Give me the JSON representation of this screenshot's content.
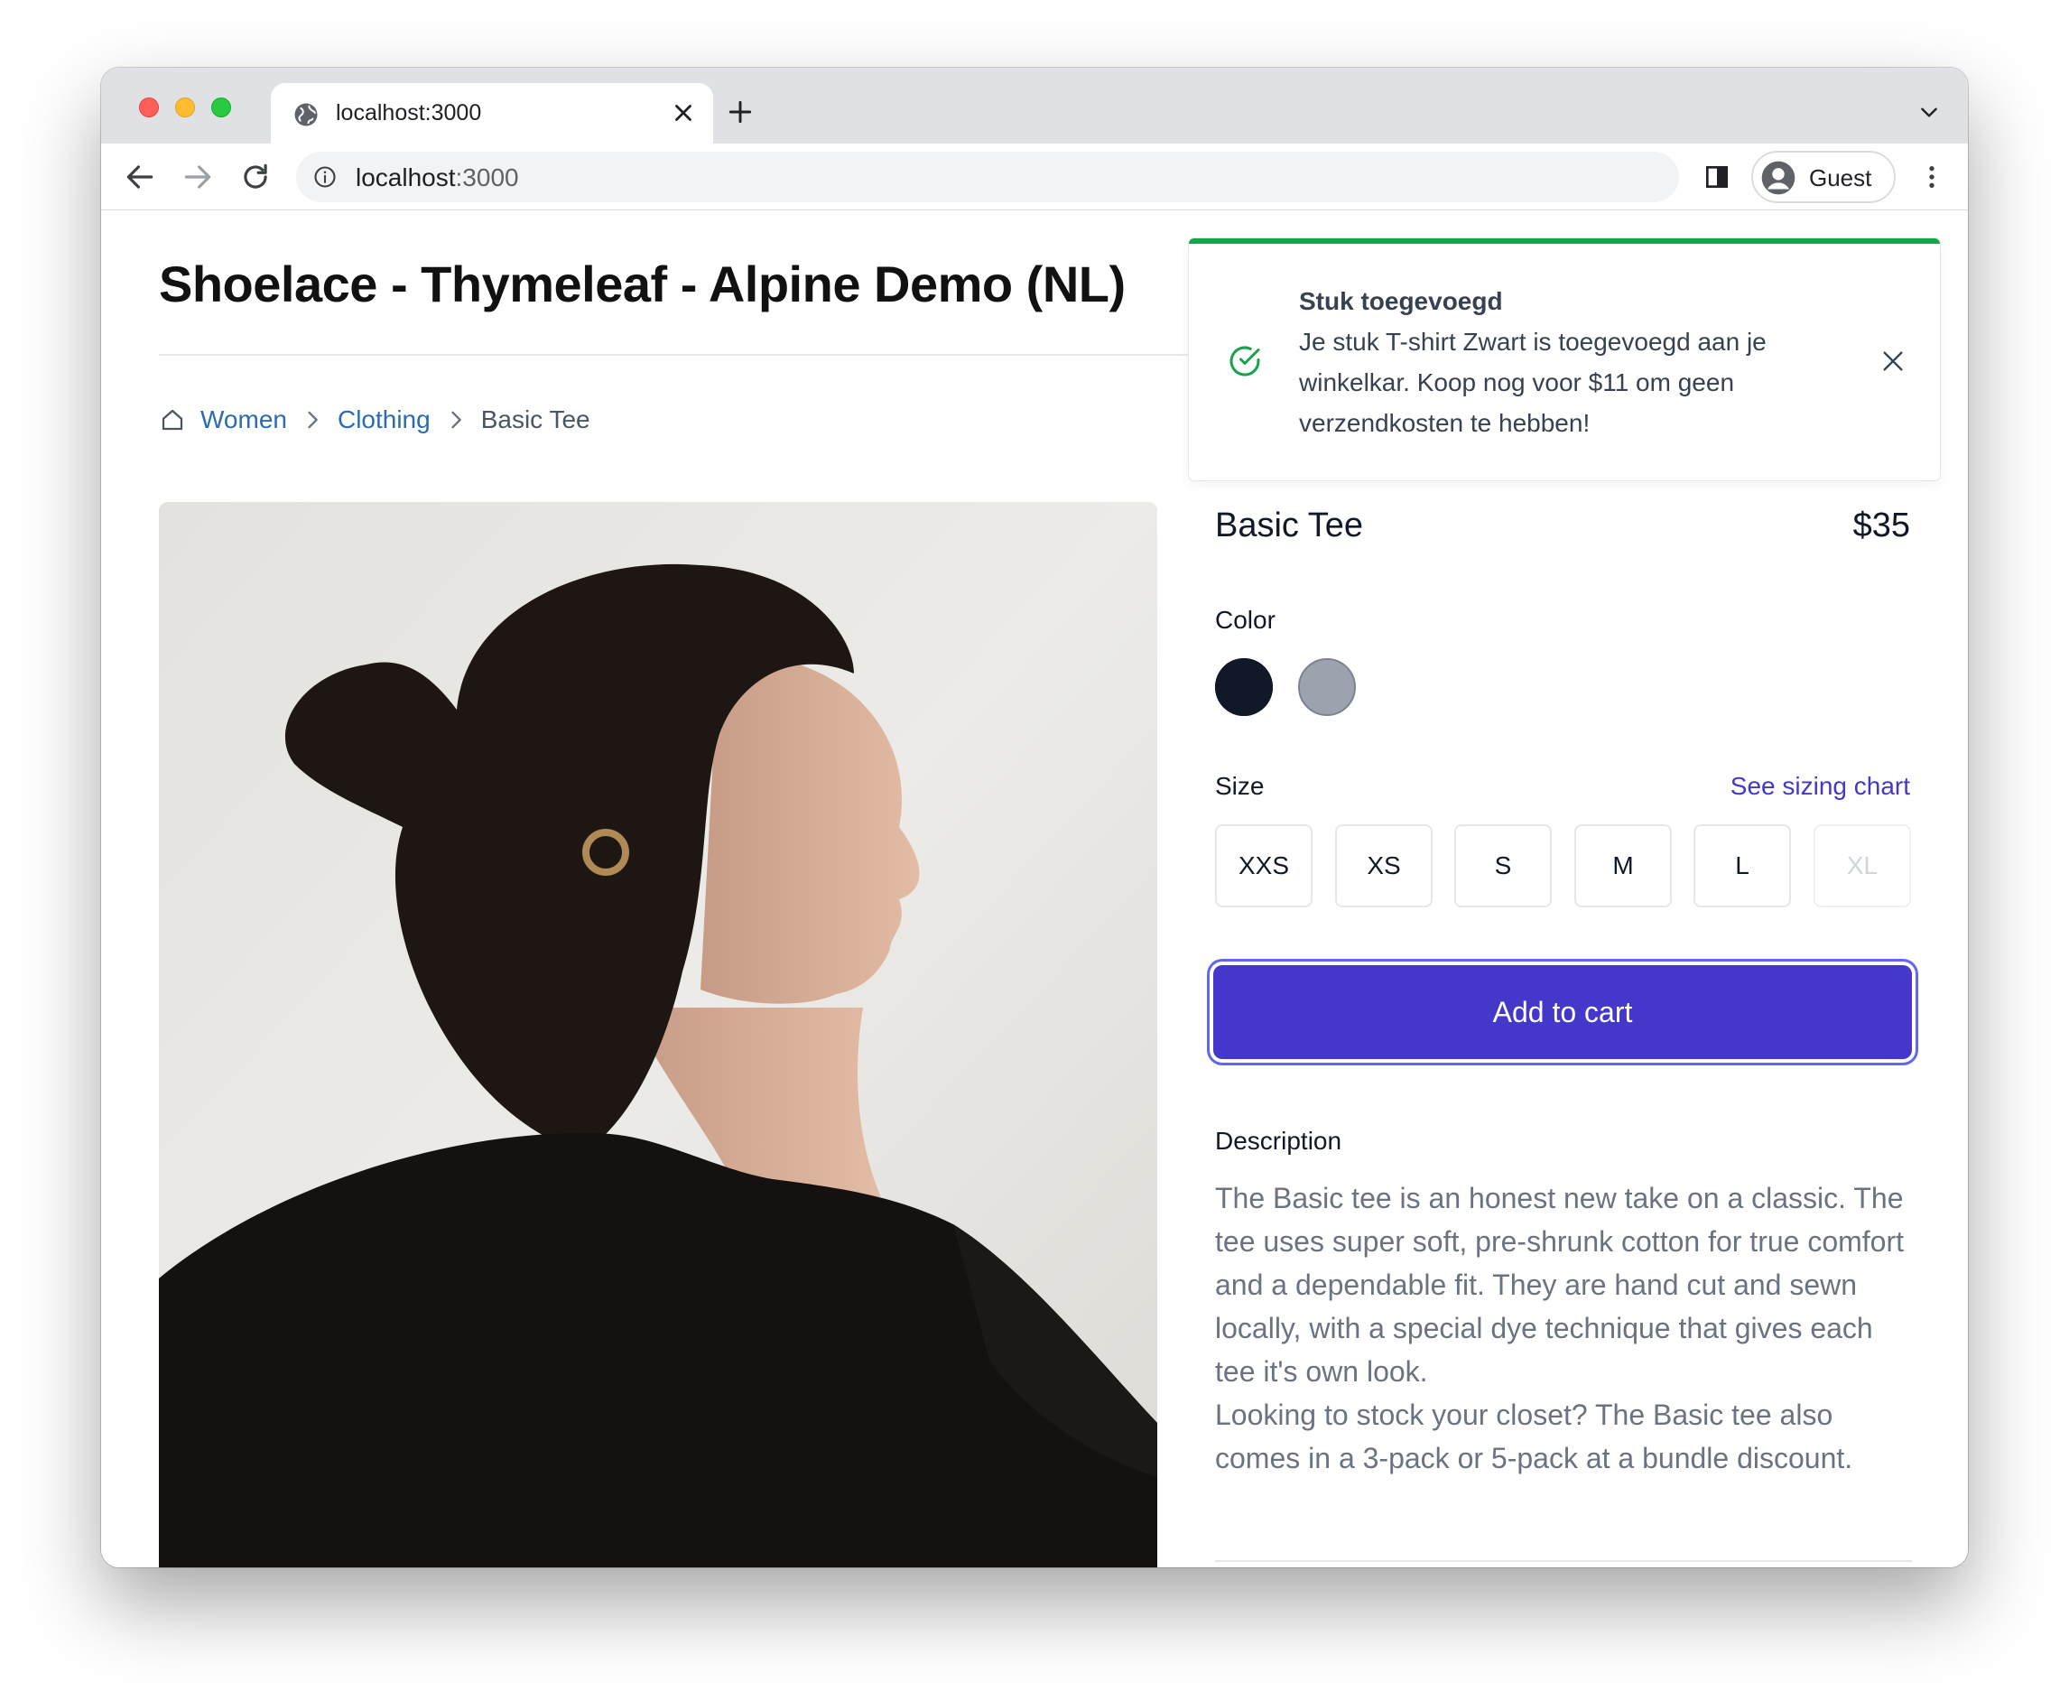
{
  "browser": {
    "tab_title": "localhost:3000",
    "url_host": "localhost",
    "url_port": ":3000",
    "profile_label": "Guest"
  },
  "page": {
    "title": "Shoelace - Thymeleaf - Alpine Demo (NL)"
  },
  "breadcrumb": {
    "items": [
      "Women",
      "Clothing"
    ],
    "current": "Basic Tee"
  },
  "toast": {
    "title": "Stuk toegevoegd",
    "message": "Je stuk T-shirt Zwart is toegevoegd aan je winkelkar. Koop nog voor $11 om geen verzendkosten te hebben!",
    "status_color": "#16a34a"
  },
  "product": {
    "name": "Basic Tee",
    "price": "$35",
    "color_label": "Color",
    "colors": [
      {
        "name": "black",
        "hex": "#111827",
        "selected": true
      },
      {
        "name": "gray",
        "hex": "#9ca3af",
        "selected": false
      }
    ],
    "size_label": "Size",
    "sizing_chart_link": "See sizing chart",
    "sizes": [
      {
        "label": "XXS",
        "available": true
      },
      {
        "label": "XS",
        "available": true
      },
      {
        "label": "S",
        "available": true
      },
      {
        "label": "M",
        "available": true
      },
      {
        "label": "L",
        "available": true
      },
      {
        "label": "XL",
        "available": false
      }
    ],
    "add_to_cart_label": "Add to cart",
    "accent_color": "#4338ca",
    "description_label": "Description",
    "description_text": "The Basic tee is an honest new take on a classic. The tee uses super soft, pre-shrunk cotton for true comfort and a dependable fit. They are hand cut and sewn locally, with a special dye technique that gives each tee it's own look.\nLooking to stock your closet? The Basic tee also comes in a 3-pack or 5-pack at a bundle discount."
  }
}
